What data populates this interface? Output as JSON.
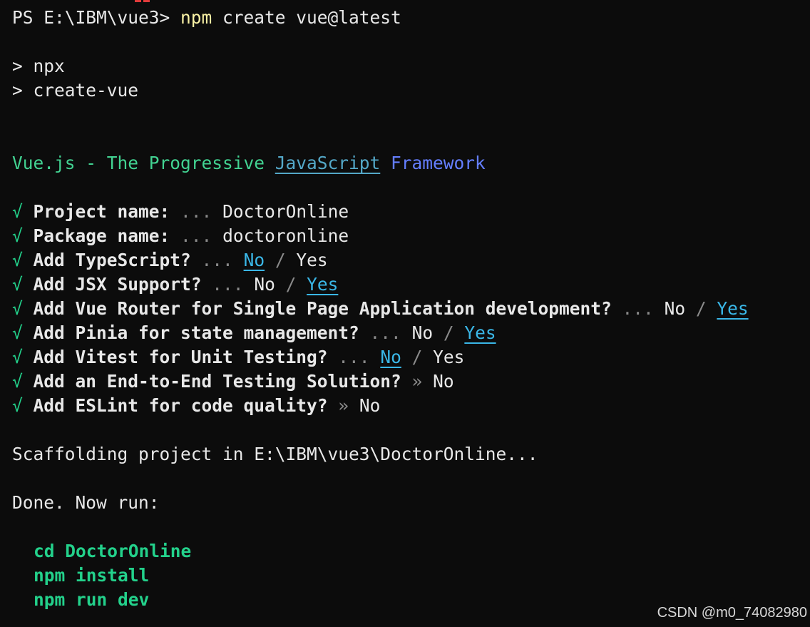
{
  "prompt": {
    "prefix": "PS E:\\IBM\\vue3> ",
    "command": "npm",
    "args": " create vue@latest"
  },
  "npx_lines": [
    "> npx",
    "> create-vue"
  ],
  "banner": {
    "part1": "Vue.js - The Progressive ",
    "part2": "JavaScript",
    "part3": " Framework"
  },
  "questions": [
    {
      "check": "√",
      "label": "Project name:",
      "sep": " ... ",
      "answer": "DoctorOnline"
    },
    {
      "check": "√",
      "label": "Package name:",
      "sep": " ... ",
      "answer": "doctoronline"
    },
    {
      "check": "√",
      "label": "Add TypeScript?",
      "sep": " ... ",
      "no": "No",
      "slash": " / ",
      "yes": "Yes",
      "selected": "No"
    },
    {
      "check": "√",
      "label": "Add JSX Support?",
      "sep": " ... ",
      "no": "No",
      "slash": " / ",
      "yes": "Yes",
      "selected": "Yes"
    },
    {
      "check": "√",
      "label": "Add Vue Router for Single Page Application development?",
      "sep": " ... ",
      "no": "No",
      "slash": " / ",
      "yes": "Yes",
      "selected": "Yes"
    },
    {
      "check": "√",
      "label": "Add Pinia for state management?",
      "sep": " ... ",
      "no": "No",
      "slash": " / ",
      "yes": "Yes",
      "selected": "Yes"
    },
    {
      "check": "√",
      "label": "Add Vitest for Unit Testing?",
      "sep": " ... ",
      "no": "No",
      "slash": " / ",
      "yes": "Yes",
      "selected": "No"
    },
    {
      "check": "√",
      "label": "Add an End-to-End Testing Solution?",
      "sep": " » ",
      "answer": "No"
    },
    {
      "check": "√",
      "label": "Add ESLint for code quality?",
      "sep": " » ",
      "answer": "No"
    }
  ],
  "scaffold": "Scaffolding project in E:\\IBM\\vue3\\DoctorOnline...",
  "done": "Done. Now run:",
  "next_steps": [
    "cd DoctorOnline",
    "npm install",
    "npm run dev"
  ],
  "watermark": "CSDN @m0_74082980",
  "colors": {
    "background": "#0c0c0c",
    "vue_green": "#42d392",
    "vue_blue": "#647eff",
    "selected_option": "#3ab7e7",
    "check": "#23d18b",
    "command": "#f9f1a5"
  }
}
